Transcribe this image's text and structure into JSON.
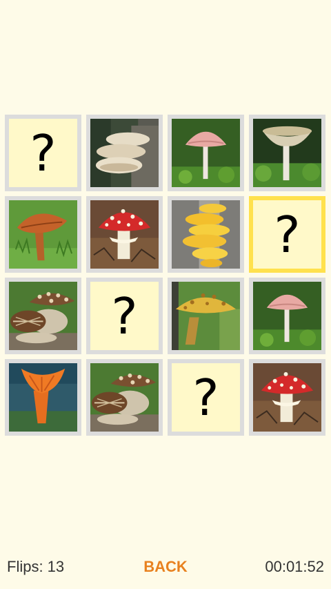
{
  "board": {
    "rows": 4,
    "cols": 4,
    "cards": [
      {
        "state": "hidden",
        "label": "?"
      },
      {
        "state": "revealed",
        "mushroom": "oyster-mushroom-icon"
      },
      {
        "state": "revealed",
        "mushroom": "pink-cap-mushroom-icon"
      },
      {
        "state": "revealed",
        "mushroom": "funnel-mushroom-icon"
      },
      {
        "state": "revealed",
        "mushroom": "brown-cap-mushroom-icon"
      },
      {
        "state": "revealed",
        "mushroom": "fly-agaric-mushroom-icon"
      },
      {
        "state": "revealed",
        "mushroom": "sulphur-shelf-mushroom-icon"
      },
      {
        "state": "hidden",
        "label": "?",
        "selected": true
      },
      {
        "state": "revealed",
        "mushroom": "scaly-hedgehog-mushroom-icon"
      },
      {
        "state": "hidden",
        "label": "?"
      },
      {
        "state": "revealed",
        "mushroom": "golden-scaly-mushroom-icon"
      },
      {
        "state": "revealed",
        "mushroom": "pink-cap-mushroom-icon"
      },
      {
        "state": "revealed",
        "mushroom": "orange-chanterelle-mushroom-icon"
      },
      {
        "state": "revealed",
        "mushroom": "scaly-hedgehog-mushroom-icon"
      },
      {
        "state": "hidden",
        "label": "?"
      },
      {
        "state": "revealed",
        "mushroom": "fly-agaric-mushroom-icon"
      }
    ]
  },
  "footer": {
    "flips": "Flips: 13",
    "back_label": "BACK",
    "timer": "00:01:52"
  },
  "colors": {
    "background": "#fefbe8",
    "card_border": "#dcdcdc",
    "selected_border": "#ffe14d",
    "hidden_face": "#fff9c9",
    "back_button": "#e8811f"
  }
}
